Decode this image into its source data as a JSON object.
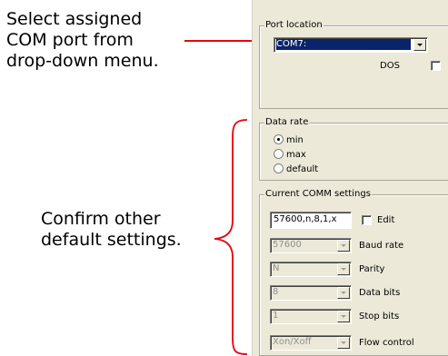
{
  "callouts": {
    "top": [
      "Select assigned",
      "COM port from",
      "drop-down menu."
    ],
    "bottom": [
      "Confirm other",
      "default settings."
    ]
  },
  "colors": {
    "arrow": "#e8000b",
    "brace": "#e8000b",
    "selection": "#0a246a"
  },
  "port_location": {
    "title": "Port location",
    "selected_value": "COM7:",
    "dos_label": "DOS",
    "dos_checked": false
  },
  "data_rate": {
    "title": "Data rate",
    "options": [
      {
        "label": "min",
        "checked": true
      },
      {
        "label": "max",
        "checked": false
      },
      {
        "label": "default",
        "checked": false
      }
    ]
  },
  "comm_settings": {
    "title": "Current COMM settings",
    "summary_value": "57600,n,8,1,x",
    "edit_label": "Edit",
    "edit_checked": false,
    "baud_rate": {
      "value": "57600",
      "label": "Baud rate"
    },
    "parity": {
      "value": "N",
      "label": "Parity"
    },
    "data_bits": {
      "value": "8",
      "label": "Data bits"
    },
    "stop_bits": {
      "value": "1",
      "label": "Stop bits"
    },
    "flow_control": {
      "value": "Xon/Xoff",
      "label": "Flow control"
    }
  }
}
